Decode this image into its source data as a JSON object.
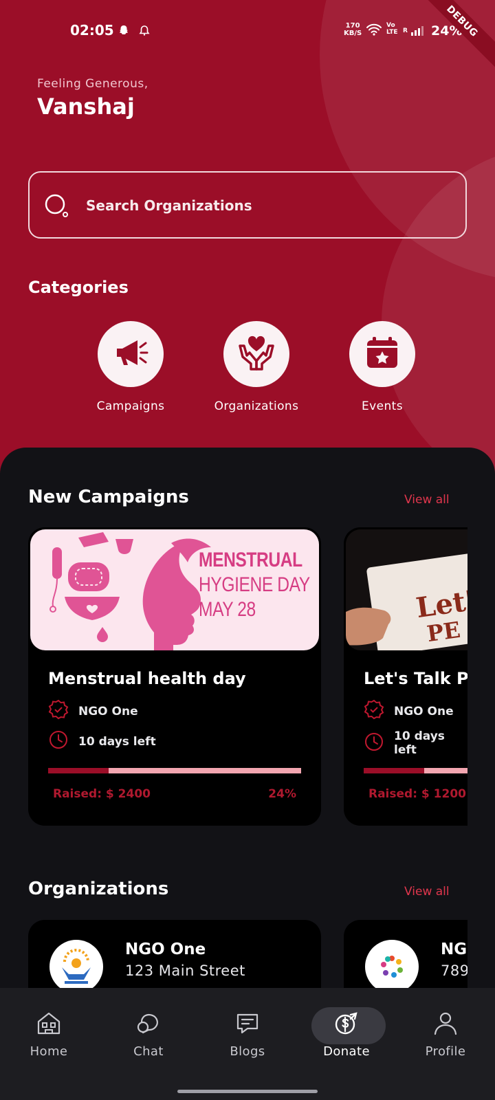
{
  "status_bar": {
    "time": "02:05",
    "net_speed_value": "170",
    "net_speed_unit": "KB/S",
    "volte_top": "Vo",
    "volte_bottom": "LTE",
    "signal_r": "R",
    "battery": "24%",
    "icons": [
      "snapchat-icon",
      "alarm-icon",
      "wifi-icon",
      "signal-icon"
    ]
  },
  "debug_banner": "DEBUG",
  "header": {
    "greeting": "Feeling Generous,",
    "user_name": "Vanshaj",
    "search_placeholder": "Search Organizations"
  },
  "categories": {
    "title": "Categories",
    "items": [
      {
        "label": "Campaigns",
        "icon": "megaphone-icon"
      },
      {
        "label": "Organizations",
        "icon": "hands-heart-icon"
      },
      {
        "label": "Events",
        "icon": "calendar-star-icon"
      }
    ]
  },
  "campaigns": {
    "title": "New Campaigns",
    "view_all": "View all",
    "items": [
      {
        "banner_line1": "MENSTRUAL",
        "banner_line2": "HYGIENE DAY",
        "banner_line3": "MAY 28",
        "title": "Menstrual health day",
        "org": "NGO One",
        "days_left": "10 days left",
        "raised": "Raised: $ 2400",
        "percent_label": "24%",
        "progress": 0.24
      },
      {
        "banner_text_line1": "Let's",
        "banner_text_line2": "PE",
        "title": "Let's Talk Periods",
        "org": "NGO One",
        "days_left": "10 days left",
        "raised": "Raised: $ 1200",
        "progress": 0.24
      }
    ]
  },
  "organizations": {
    "title": "Organizations",
    "view_all": "View all",
    "items": [
      {
        "name": "NGO One",
        "address": "123 Main Street"
      },
      {
        "name": "NGO Two",
        "address": "789"
      }
    ]
  },
  "bottom_nav": {
    "items": [
      {
        "label": "Home",
        "icon": "home-icon"
      },
      {
        "label": "Chat",
        "icon": "chat-icon"
      },
      {
        "label": "Blogs",
        "icon": "blogs-icon"
      },
      {
        "label": "Donate",
        "icon": "donate-icon",
        "active": true
      },
      {
        "label": "Profile",
        "icon": "profile-icon"
      }
    ]
  },
  "colors": {
    "brand": "#9b0e28",
    "accent": "#e0364d",
    "panel": "#121216",
    "card": "#000000",
    "progress_track": "#f2a6b0"
  }
}
